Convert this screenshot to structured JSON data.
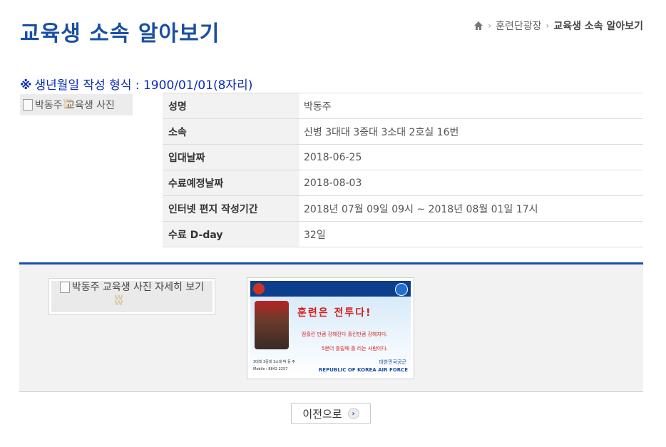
{
  "page": {
    "title": "교육생 소속 알아보기"
  },
  "breadcrumb": {
    "items": [
      "훈련단광장",
      "교육생 소속 알아보기"
    ],
    "separator": "›"
  },
  "notice": {
    "mark": "※",
    "text": "생년월일 작성 형식 : 1900/01/01(8자리)"
  },
  "photo": {
    "thumb_alt": "박동주 교육생 사진",
    "detail_alt": "박동주 교육생 사진 자세히 보기"
  },
  "info_table": {
    "rows": [
      {
        "label": "성명",
        "value": "박동주"
      },
      {
        "label": "소속",
        "value": "신병 3대대 3중대 3소대 2호실 16번"
      },
      {
        "label": "입대날짜",
        "value": "2018-06-25"
      },
      {
        "label": "수료예정날짜",
        "value": "2018-08-03"
      },
      {
        "label": "인터넷 편지 작성기간",
        "value": "2018년 07월 09일 09시 ~ 2018년 08월 01일 17시"
      },
      {
        "label": "수료 D-day",
        "value": "32일"
      }
    ]
  },
  "card": {
    "headline": "훈련은 전투다!",
    "line1": "땀흘린 만큼 강해진다 흘린만큼 강해지다.",
    "line2": "5분더 흘릴때 흘 리는 사람이다.",
    "unit": "3대대 3중대 3소대 박 동 주",
    "mobile": "Mobile : 8842 2257",
    "kaf": "대한민국공군",
    "kaf_en": "REPUBLIC OF KOREA AIR FORCE"
  },
  "buttons": {
    "prev_label": "이전으로"
  },
  "colors": {
    "title": "#1a4fa3",
    "notice": "#0b2bb8",
    "divider": "#1a4fa3"
  }
}
